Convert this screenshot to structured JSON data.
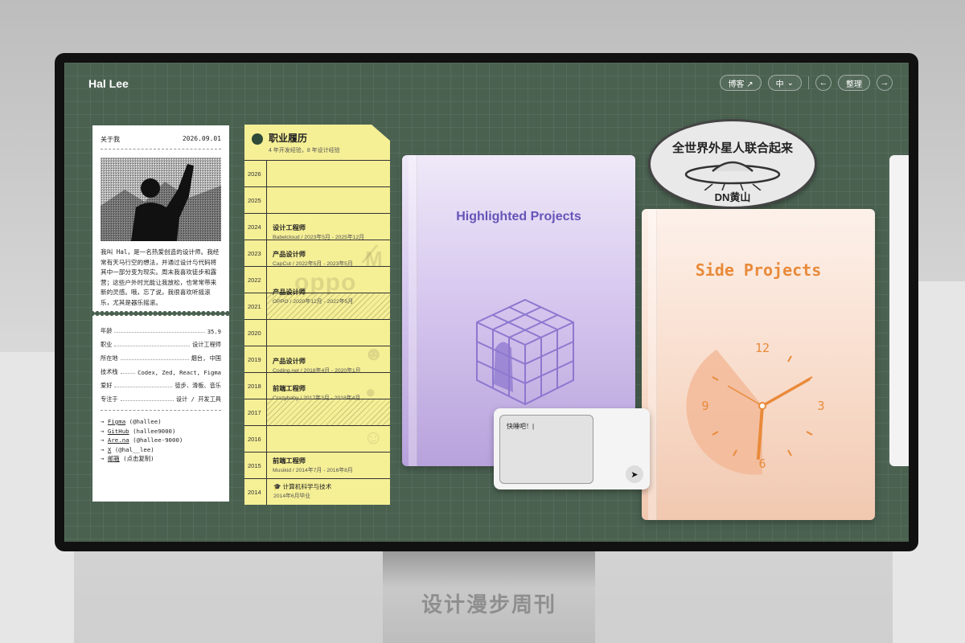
{
  "header": {
    "brand": "Hal Lee",
    "blog": "博客 ↗",
    "lang": "中",
    "prev": "←",
    "arrange": "整理",
    "next": "→"
  },
  "about": {
    "title": "关于我",
    "date": "2026.09.01",
    "bio": "我叫 Hal，是一名热爱创造的设计师。我经常有天马行空的想法，并通过设计与代码将其中一部分变为现实。周末我喜欢徒步和露营；这些户外时光能让我放松，也常常带来新的灵感。哦，忘了说，我很喜欢听摇滚乐，尤其是器乐摇滚。",
    "facts": [
      {
        "k": "年龄",
        "v": "35.9"
      },
      {
        "k": "职业",
        "v": "设计工程师"
      },
      {
        "k": "所在地",
        "v": "烟台, 中国"
      },
      {
        "k": "技术栈",
        "v": "Codex, Zed, React, Figma"
      },
      {
        "k": "爱好",
        "v": "徒步、滑板、音乐"
      },
      {
        "k": "专注于",
        "v": "设计 / 开发工具"
      }
    ],
    "links": [
      {
        "name": "Figma",
        "handle": "(@hallee)"
      },
      {
        "name": "GitHub",
        "handle": "(hallee9000)"
      },
      {
        "name": "Are.na",
        "handle": "(@hallee-9000)"
      },
      {
        "name": "X",
        "handle": "(@hal__lee)"
      },
      {
        "name": "邮箱",
        "handle": "(点击复制)"
      }
    ]
  },
  "career": {
    "title": "职业履历",
    "subtitle": "4 年开发经验，8 年设计经验",
    "years": [
      "2026",
      "2025",
      "2024",
      "2023",
      "2022",
      "2021",
      "2020",
      "2019",
      "2018",
      "2017",
      "2016",
      "2015",
      "2014"
    ],
    "jobs": [
      {
        "role": "设计工程师",
        "detail": "Babelcloud  /  2023年5月 - 2025年12月"
      },
      {
        "role": "产品设计师",
        "detail": "CapCut  /  2022年5月 - 2023年5月"
      },
      {
        "role": "产品设计师",
        "detail": "OPPO  /  2020年12月 - 2022年5月"
      },
      {
        "role": "产品设计师",
        "detail": "Coding.net  /  2018年4月 - 2020年1月"
      },
      {
        "role": "前端工程师",
        "detail": "Crazybaby  /  2017年3月 - 2018年4月"
      },
      {
        "role": "前端工程师",
        "detail": "Musikid  /  2014年7月 - 2016年8月"
      }
    ],
    "education": {
      "major": "计算机科学与技术",
      "date": "2014年6月毕业"
    },
    "watermark_oppo": "oppo"
  },
  "books": {
    "highlighted": "Highlighted Projects",
    "side": "Side Projects"
  },
  "badge": {
    "line1": "全世界外星人联合起来",
    "line2": "DN黄山"
  },
  "clock": {
    "n12": "12",
    "n3": "3",
    "n6": "6",
    "n9": "9"
  },
  "chat": {
    "text": "快睡吧！"
  },
  "stand_text": "设计漫步周刊",
  "colors": {
    "screen": "#4a6150",
    "timeline": "#f5ef96",
    "accent_orange": "#e98a3a",
    "accent_purple": "#6654b8"
  }
}
